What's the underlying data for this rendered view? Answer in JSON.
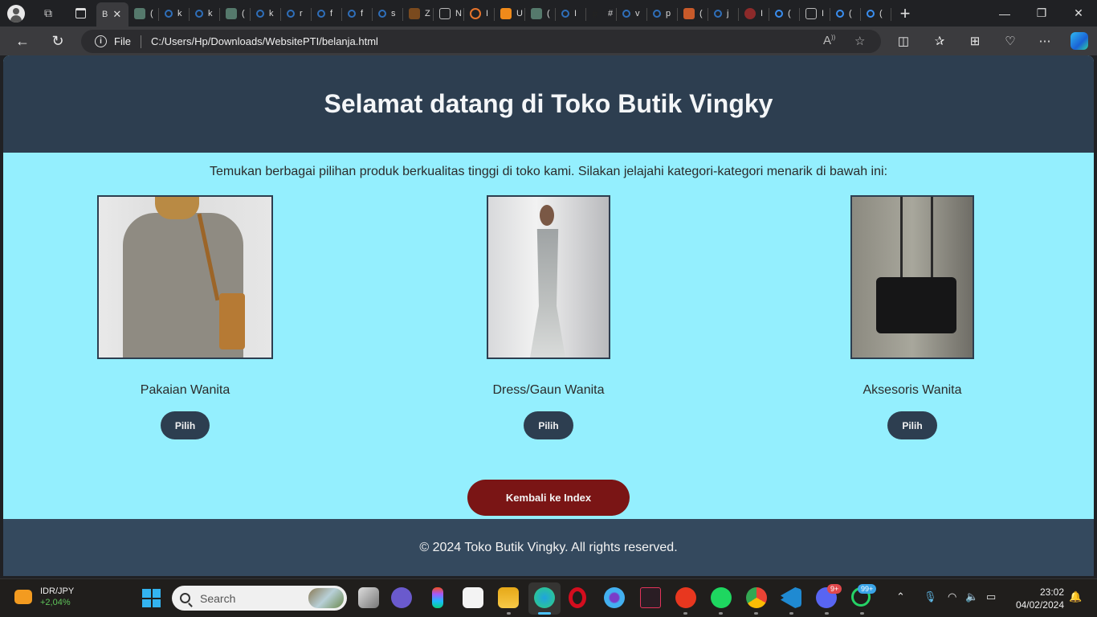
{
  "browser": {
    "active_tab_label": "B",
    "tabs": [
      {
        "icon": "chatgpt-icon",
        "label": "("
      },
      {
        "icon": "search-icon",
        "label": "k"
      },
      {
        "icon": "search-icon",
        "label": "k"
      },
      {
        "icon": "chatgpt-icon",
        "label": "("
      },
      {
        "icon": "search-icon",
        "label": "k"
      },
      {
        "icon": "search-icon",
        "label": "r"
      },
      {
        "icon": "search-icon",
        "label": "f"
      },
      {
        "icon": "search-icon",
        "label": "f"
      },
      {
        "icon": "search-icon",
        "label": "s"
      },
      {
        "icon": "mendeley-icon",
        "label": "Z"
      },
      {
        "icon": "calendar-icon",
        "label": "N"
      },
      {
        "icon": "arc-icon",
        "label": "I"
      },
      {
        "icon": "book-icon",
        "label": "U"
      },
      {
        "icon": "chatgpt-icon",
        "label": "("
      },
      {
        "icon": "search-icon",
        "label": "I"
      },
      {
        "icon": "hash-icon",
        "label": "#"
      },
      {
        "icon": "search-icon",
        "label": "v"
      },
      {
        "icon": "search-icon",
        "label": "p"
      },
      {
        "icon": "six-icon",
        "label": "("
      },
      {
        "icon": "search-icon",
        "label": "j"
      },
      {
        "icon": "strawberry-icon",
        "label": "I"
      },
      {
        "icon": "search-icon",
        "label": "("
      },
      {
        "icon": "calendar-icon",
        "label": "I"
      },
      {
        "icon": "search-icon",
        "label": "("
      },
      {
        "icon": "search-icon",
        "label": "("
      }
    ],
    "address_scheme_label": "File",
    "url": "C:/Users/Hp/Downloads/WebsitePTI/belanja.html"
  },
  "page": {
    "title": "Selamat datang di Toko Butik Vingky",
    "intro": "Temukan berbagai pilihan produk berkualitas tinggi di toko kami. Silakan jelajahi kategori-kategori menarik di bawah ini:",
    "categories": [
      {
        "name": "Pakaian Wanita",
        "button": "Pilih",
        "image": "blouse-photo"
      },
      {
        "name": "Dress/Gaun Wanita",
        "button": "Pilih",
        "image": "gown-photo"
      },
      {
        "name": "Aksesoris Wanita",
        "button": "Pilih",
        "image": "handbag-photo"
      }
    ],
    "back_button": "Kembali ke Index",
    "footer": "© 2024 Toko Butik Vingky. All rights reserved.",
    "colors": {
      "header_bg": "#2d3e50",
      "page_bg": "#94effe",
      "button_bg": "#2d3e50",
      "back_button_bg": "#7a1515",
      "footer_bg": "#34495e"
    }
  },
  "taskbar": {
    "widget_pair": "IDR/JPY",
    "widget_change": "+2,04%",
    "search_placeholder": "Search",
    "discord_badge": "9+",
    "whatsapp_badge": "99+",
    "time": "23:02",
    "date": "04/02/2024"
  }
}
